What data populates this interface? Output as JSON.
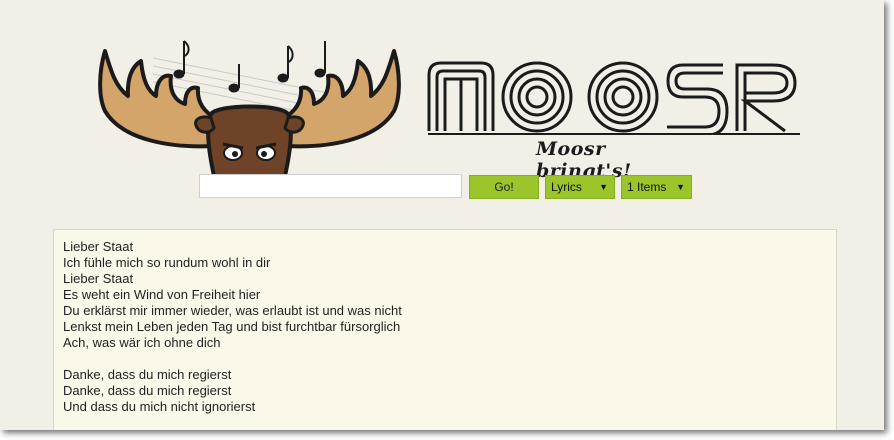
{
  "brand": {
    "wordmark": "MO OSR",
    "tagline": "Moosr bringt's!",
    "logo_icon": "moose-head-with-music-notes"
  },
  "search": {
    "value": "",
    "placeholder": "",
    "go_label": "Go!",
    "mode_label": "Lyrics",
    "count_label": "1 Items"
  },
  "lyrics": {
    "lines": [
      "Lieber Staat",
      "Ich fühle mich so rundum wohl in dir",
      "Lieber Staat",
      "Es weht ein Wind von Freiheit hier",
      "Du erklärst mir immer wieder, was erlaubt ist und was nicht",
      "Lenkst mein Leben jeden Tag und bist furchtbar fürsorglich",
      "Ach, was wär ich ohne dich",
      "",
      "Danke, dass du mich regierst",
      "Danke, dass du mich regierst",
      "Und dass du mich nicht ignorierst"
    ]
  },
  "colors": {
    "background": "#f2f0e6",
    "accent_green": "#9cc42b",
    "lyrics_bg": "#fbf8e9",
    "antler": "#d3a56a",
    "moose_head": "#6f4328"
  }
}
